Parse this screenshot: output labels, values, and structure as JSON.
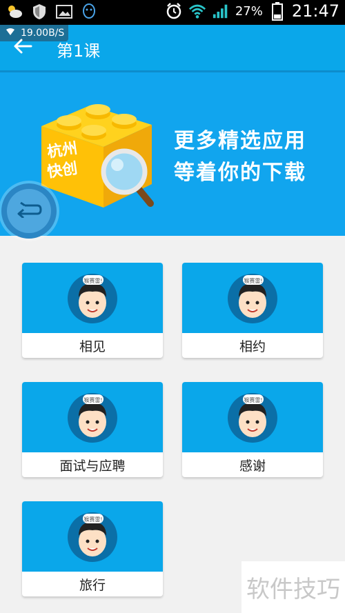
{
  "status_bar": {
    "battery_percent": "27%",
    "time": "21:47",
    "icons": [
      "weather-icon",
      "shield-icon",
      "image-icon",
      "qq-icon",
      "alarm-icon",
      "wifi-icon",
      "signal-icon",
      "battery-icon"
    ]
  },
  "network_speed": "19.00B/S",
  "app_bar": {
    "title": "第1课",
    "back_icon": "back-arrow-icon"
  },
  "banner": {
    "box_text_line1": "杭州",
    "box_text_line2": "快创",
    "line1": "更多精选应用",
    "line2": "等着你的下载"
  },
  "lessons": [
    {
      "label": "相见",
      "bubble": "猴赛雷!"
    },
    {
      "label": "相约",
      "bubble": "猴赛雷!"
    },
    {
      "label": "面试与应聘",
      "bubble": "猴赛雷!"
    },
    {
      "label": "感谢",
      "bubble": "猴赛雷!"
    },
    {
      "label": "旅行",
      "bubble": "猴赛雷!"
    }
  ],
  "watermark": "软件技巧",
  "colors": {
    "primary": "#0aa7ea",
    "banner": "#11a5ee",
    "floating_button": "#2b86c4",
    "background": "#f1f1f1"
  }
}
